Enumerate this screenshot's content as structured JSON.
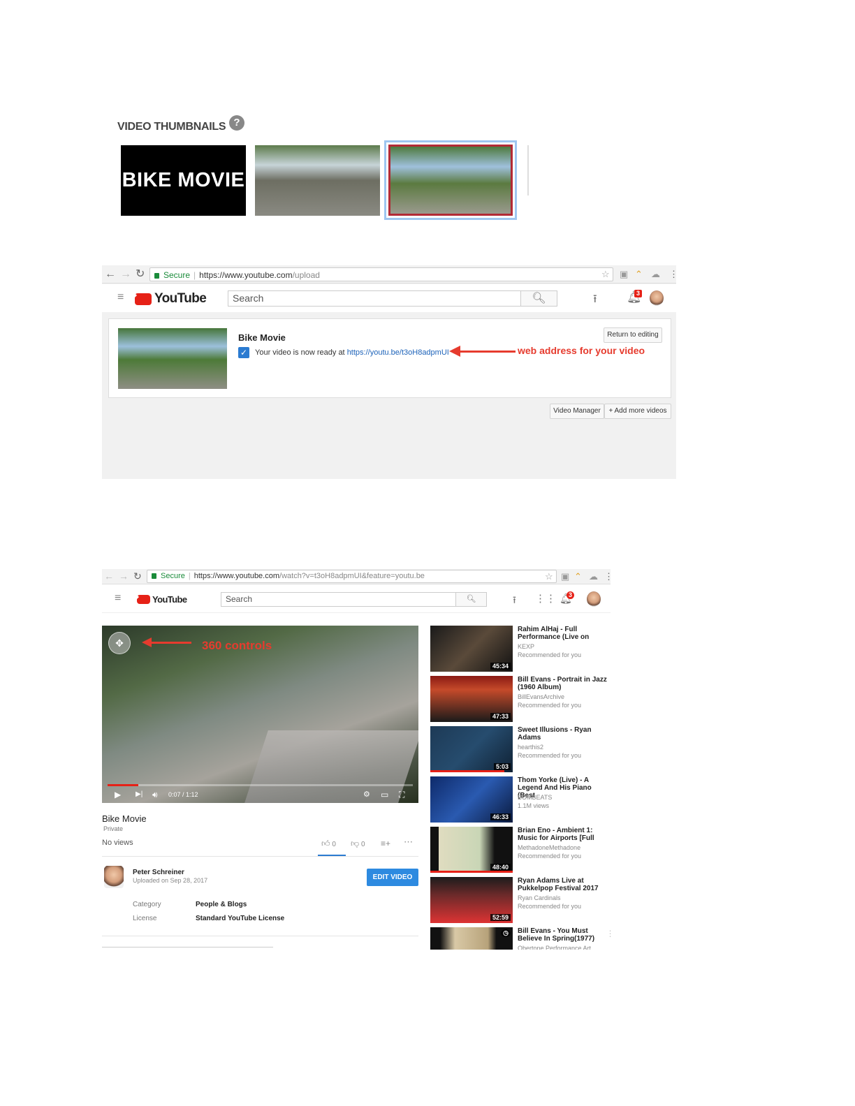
{
  "thumbnails": {
    "title": "VIDEO THUMBNAILS",
    "help_glyph": "?",
    "thumb1_text": "BIKE MOVIE"
  },
  "upload_page": {
    "address": {
      "secure": "Secure",
      "scheme": "https://",
      "host": "www.youtube.com",
      "path": "/upload"
    },
    "logo": "YouTube",
    "search_placeholder": "Search",
    "notification_count": "3",
    "card": {
      "title": "Bike Movie",
      "ready_text": "Your video is now ready at ",
      "link": "https://youtu.be/t3oH8adpmUI",
      "return_button": "Return to editing"
    },
    "annotation": "web address for your video",
    "video_manager_button": "Video Manager",
    "add_more_button": "+ Add more videos"
  },
  "watch_page": {
    "address": {
      "secure": "Secure",
      "scheme": "https://",
      "host": "www.youtube.com",
      "path": "/watch?v=t3oH8adpmUI&feature=youtu.be"
    },
    "logo": "YouTube",
    "search_placeholder": "Search",
    "notification_count": "3",
    "annotation": "360 controls",
    "player": {
      "time": "0:07 / 1:12",
      "progress": 0.1
    },
    "video": {
      "title": "Bike Movie",
      "privacy": "Private",
      "views": "No views",
      "likes": "0",
      "dislikes": "0"
    },
    "owner": {
      "name": "Peter Schreiner",
      "uploaded": "Uploaded on Sep 28, 2017",
      "edit_button": "EDIT VIDEO"
    },
    "meta": {
      "category_label": "Category",
      "category_value": "People & Blogs",
      "license_label": "License",
      "license_value": "Standard YouTube License"
    },
    "recommendations": [
      {
        "title": "Rahim AlHaj - Full Performance (Live on",
        "channel": "KEXP",
        "sub": "Recommended for you",
        "duration": "45:34",
        "progress": 0
      },
      {
        "title": "Bill Evans - Portrait in Jazz (1960 Album)",
        "channel": "BillEvansArchive",
        "sub": "Recommended for you",
        "duration": "47:33",
        "progress": 0
      },
      {
        "title": "Sweet Illusions - Ryan Adams",
        "channel": "hearthis2",
        "sub": "Recommended for you",
        "duration": "5:03",
        "progress": 0.9
      },
      {
        "title": "Thom Yorke (Live) - A Legend And His Piano (Best",
        "channel": "BOMBEATS",
        "sub": "1.1M views",
        "duration": "46:33",
        "progress": 0
      },
      {
        "title": "Brian Eno - Ambient 1: Music for Airports [Full",
        "channel": "MethadoneMethadone",
        "sub": "Recommended for you",
        "duration": "48:40",
        "progress": 1.0
      },
      {
        "title": "Ryan Adams Live at Pukkelpop Festival 2017",
        "channel": "Ryan Cardinals",
        "sub": "Recommended for you",
        "duration": "52:59",
        "progress": 0
      },
      {
        "title": "Bill Evans - You Must Believe In Spring(1977)",
        "channel": "Obertone Performance Art",
        "sub": "",
        "duration": "",
        "progress": 0
      }
    ]
  }
}
